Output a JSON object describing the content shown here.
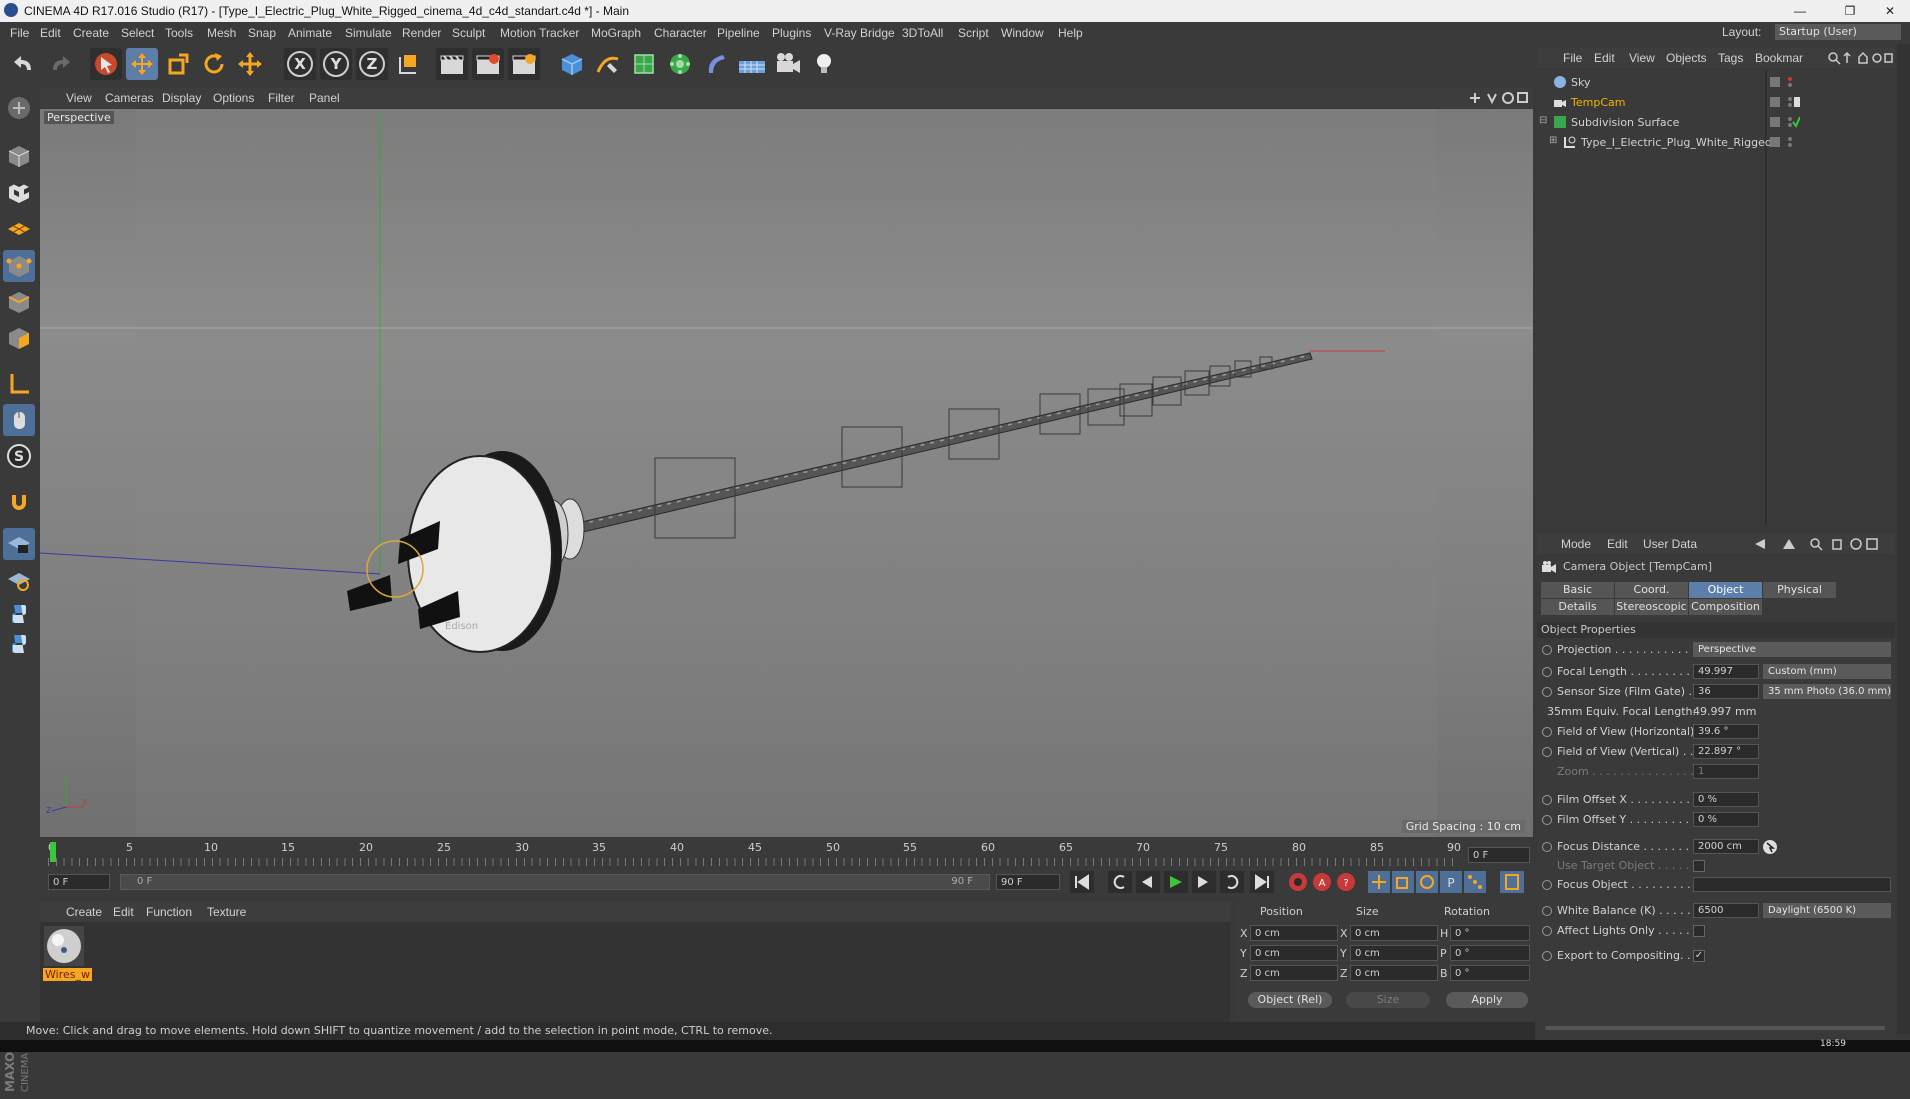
{
  "window": {
    "title": "CINEMA 4D R17.016 Studio (R17) - [Type_I_Electric_Plug_White_Rigged_cinema_4d_c4d_standart.c4d *] - Main"
  },
  "menubar": {
    "items": [
      "File",
      "Edit",
      "Create",
      "Select",
      "Tools",
      "Mesh",
      "Snap",
      "Animate",
      "Simulate",
      "Render",
      "Sculpt",
      "Motion Tracker",
      "MoGraph",
      "Character",
      "Pipeline",
      "Plugins",
      "V-Ray Bridge",
      "3DToAll",
      "Script",
      "Window",
      "Help"
    ],
    "layout_label": "Layout:",
    "layout_value": "Startup (User)"
  },
  "viewport": {
    "menu": [
      "View",
      "Cameras",
      "Display",
      "Options",
      "Filter",
      "Panel"
    ],
    "label": "Perspective",
    "grid_spacing": "Grid Spacing : 10 cm"
  },
  "timeline": {
    "ticks": [
      "0",
      "5",
      "10",
      "15",
      "20",
      "25",
      "30",
      "35",
      "40",
      "45",
      "50",
      "55",
      "60",
      "65",
      "70",
      "75",
      "80",
      "85",
      "90"
    ],
    "current_frame": "0 F",
    "start_frame": "0 F",
    "slider_start": "0 F",
    "slider_end": "90 F",
    "end_frame": "90 F",
    "end_field": "90 F"
  },
  "material_manager": {
    "menu": [
      "Create",
      "Edit",
      "Function",
      "Texture"
    ],
    "material_name": "Wires_w"
  },
  "coordinates": {
    "headers": [
      "Position",
      "Size",
      "Rotation"
    ],
    "rows": [
      {
        "axis": "X",
        "pos": "0 cm",
        "size_axis": "X",
        "size": "0 cm",
        "rot_axis": "H",
        "rot": "0 °"
      },
      {
        "axis": "Y",
        "pos": "0 cm",
        "size_axis": "Y",
        "size": "0 cm",
        "rot_axis": "P",
        "rot": "0 °"
      },
      {
        "axis": "Z",
        "pos": "0 cm",
        "size_axis": "Z",
        "size": "0 cm",
        "rot_axis": "B",
        "rot": "0 °"
      }
    ],
    "mode": "Object (Rel)",
    "size_mode": "Size",
    "apply": "Apply"
  },
  "status": "Move: Click and drag to move elements. Hold down SHIFT to quantize movement / add to the selection in point mode, CTRL to remove.",
  "object_manager": {
    "menu": [
      "File",
      "Edit",
      "View",
      "Objects",
      "Tags",
      "Bookmar"
    ],
    "objects": [
      {
        "name": "Sky",
        "color": "#d2d2d2"
      },
      {
        "name": "TempCam",
        "color": "#f5b400"
      },
      {
        "name": "Subdivision Surface",
        "color": "#d2d2d2"
      },
      {
        "name": "Type_I_Electric_Plug_White_Rigged",
        "color": "#d2d2d2"
      }
    ]
  },
  "attributes": {
    "menu": [
      "Mode",
      "Edit",
      "User Data"
    ],
    "object_title": "Camera Object [TempCam]",
    "tabs_row1": [
      "Basic",
      "Coord.",
      "Object",
      "Physical"
    ],
    "tabs_row2": [
      "Details",
      "Stereoscopic",
      "Composition"
    ],
    "active_tab": "Object",
    "section": "Object Properties",
    "props": {
      "projection_label": "Projection . . . . . . . . . . . . .",
      "projection_value": "Perspective",
      "focal_label": "Focal Length . . . . . . . . . . .",
      "focal_value": "49.997",
      "focal_preset": "Custom (mm)",
      "sensor_label": "Sensor Size (Film Gate) . .",
      "sensor_value": "36",
      "sensor_preset": "35 mm Photo (36.0 mm)",
      "equiv_label": "35mm Equiv. Focal Length:",
      "equiv_value": "49.997 mm",
      "fovh_label": "Field of View (Horizontal)",
      "fovh_value": "39.6 °",
      "fovv_label": "Field of View (Vertical) . .",
      "fovv_value": "22.897 °",
      "zoom_label": "Zoom . . . . . . . . . . . . . . . . .",
      "zoom_value": "1",
      "filmx_label": "Film Offset X . . . . . . . . . . .",
      "filmx_value": "0 %",
      "filmy_label": "Film Offset Y . . . . . . . . . . .",
      "filmy_value": "0 %",
      "focusd_label": "Focus Distance . . . . . . . . .",
      "focusd_value": "2000 cm",
      "usetarget_label": "Use Target Object . . . . . . .",
      "focusobj_label": "Focus Object . . . . . . . . . . .",
      "wb_label": "White Balance (K) . . . . . .",
      "wb_value": "6500",
      "wb_preset": "Daylight (6500 K)",
      "affect_label": "Affect Lights Only . . . . . .",
      "export_label": "Export to Compositing. . .",
      "export_check": "✓"
    }
  },
  "taskbar": {
    "clock": "18:59"
  }
}
